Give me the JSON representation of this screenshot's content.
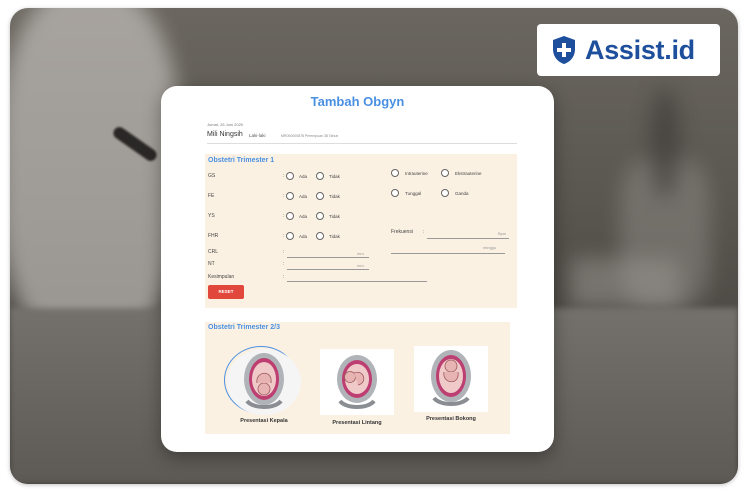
{
  "brand": {
    "name": "Assist.id",
    "color": "#1e4f9c",
    "icon": "shield-icon"
  },
  "modal": {
    "title": "Tambah Obgyn",
    "date": "Jumat, 26 Juni 2020",
    "patient_name": "Mili Ningsih",
    "patient_gender": "Laki-laki",
    "patient_meta": "MR000000878   Perempuan   38 Tahun"
  },
  "trimester1": {
    "title": "Obstetri Trimester 1",
    "rows": [
      {
        "label": "GS",
        "options": [
          "Ada",
          "Tidak"
        ]
      },
      {
        "label": "FE",
        "options": [
          "Ada",
          "Tidak"
        ]
      },
      {
        "label": "YS",
        "options": [
          "Ada",
          "Tidak"
        ]
      },
      {
        "label": "FHR",
        "options": [
          "Ada",
          "Tidak"
        ]
      }
    ],
    "location_options": [
      "Intrauterine",
      "Ekstrauterine"
    ],
    "count_options": [
      "Tunggal",
      "Ganda"
    ],
    "frekuensi_label": "Frekuensi",
    "frekuensi_unit": "Bpm",
    "minggu_unit": "minggu",
    "crl_label": "CRL",
    "crl_unit": "mm",
    "nt_label": "NT",
    "nt_unit": "mm",
    "kesimpulan_label": "Kesimpulan",
    "reset_label": "RESET"
  },
  "trimester2": {
    "title": "Obstetri Trimester 2/3",
    "presentations": [
      {
        "label": "Presentasi Kepala",
        "selected": true
      },
      {
        "label": "Presentasi Lintang",
        "selected": false
      },
      {
        "label": "Presentasi Bokong",
        "selected": false
      }
    ]
  },
  "colors": {
    "accent": "#4a90e2",
    "reset": "#e2473b",
    "section_bg": "#fbf1e3"
  }
}
